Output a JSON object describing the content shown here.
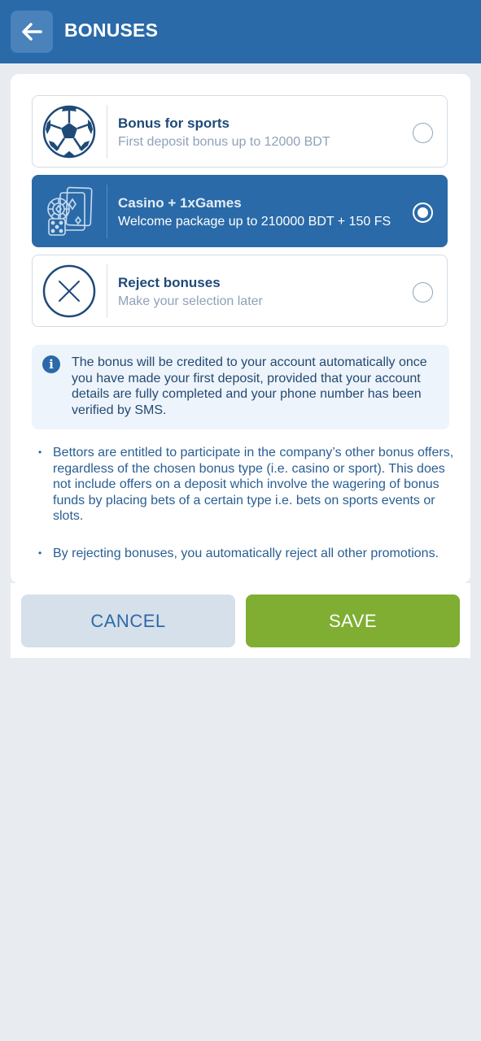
{
  "header": {
    "title": "BONUSES",
    "back_icon": "arrow-left-icon"
  },
  "options": [
    {
      "title": "Bonus for sports",
      "subtitle": "First deposit bonus up to 12000 BDT",
      "icon": "soccer-ball-icon",
      "selected": false
    },
    {
      "title": "Casino + 1xGames",
      "subtitle": "Welcome package up to 210000 BDT + 150 FS",
      "icon": "casino-cards-dice-icon",
      "selected": true
    },
    {
      "title": "Reject bonuses",
      "subtitle": "Make your selection later",
      "icon": "close-circle-icon",
      "selected": false
    }
  ],
  "info": {
    "icon": "info-icon",
    "text": "The bonus will be credited to your account automatically once you have made your first deposit, provided that your account details are fully completed and your phone number has been verified by SMS."
  },
  "bullets": [
    "Bettors are entitled to participate in the company’s other bonus offers, regardless of the chosen bonus type (i.e. casino or sport). This does not include offers on a deposit which involve the wagering of bonus funds by placing bets of a certain type i.e. bets on sports events or slots.",
    "By rejecting bonuses, you automatically reject all other promotions."
  ],
  "buttons": {
    "cancel": "CANCEL",
    "save": "SAVE"
  },
  "colors": {
    "header": "#2a6aa8",
    "selected_option": "#2a6aa8",
    "save_button": "#7fae32",
    "cancel_button": "#d6e0ea"
  }
}
